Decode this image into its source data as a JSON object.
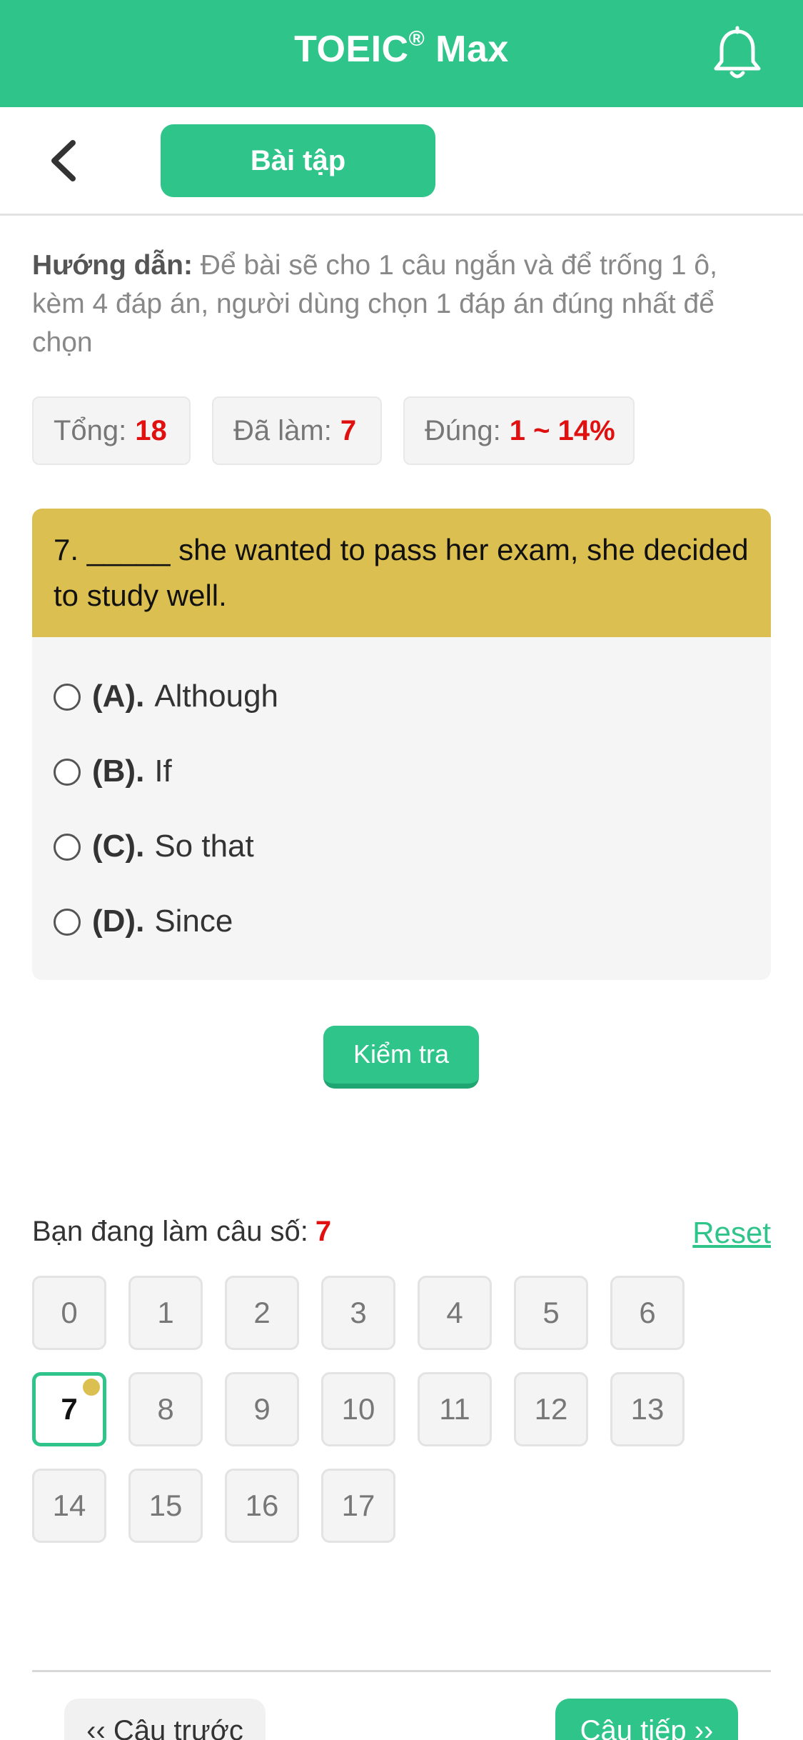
{
  "app": {
    "title": "TOEIC",
    "title_mark": "®",
    "title_suffix": " Max",
    "brand_color": "#2ec48a",
    "bell_icon": "bell-icon"
  },
  "nav": {
    "back_icon": "chevron-left-icon",
    "tab_label": "Bài tập"
  },
  "guide": {
    "label": "Hướng dẫn:",
    "text": " Để bài sẽ cho 1 câu ngắn và để trống 1 ô, kèm 4 đáp án, người dùng chọn 1 đáp án đúng nhất để chọn"
  },
  "stats": {
    "total_label": "Tổng:",
    "total_value": "18",
    "done_label": "Đã làm:",
    "done_value": "7",
    "correct_label": "Đúng:",
    "correct_value": "1 ~ 14%"
  },
  "question": {
    "text": "7. _____ she wanted to pass her exam, she decided to study well.",
    "header_color": "#dcbf51",
    "options": [
      {
        "key": "(A).",
        "text": "Although"
      },
      {
        "key": "(B).",
        "text": "If"
      },
      {
        "key": "(C).",
        "text": "So that"
      },
      {
        "key": "(D).",
        "text": "Since"
      }
    ]
  },
  "check_button": "Kiểm tra",
  "progress": {
    "label": "Bạn đang làm câu số:",
    "current": "7",
    "reset_label": "Reset"
  },
  "question_numbers": [
    "0",
    "1",
    "2",
    "3",
    "4",
    "5",
    "6",
    "7",
    "8",
    "9",
    "10",
    "11",
    "12",
    "13",
    "14",
    "15",
    "16",
    "17"
  ],
  "footer": {
    "prev_label": "‹‹ Câu trước",
    "next_label": "Câu tiếp ››"
  }
}
